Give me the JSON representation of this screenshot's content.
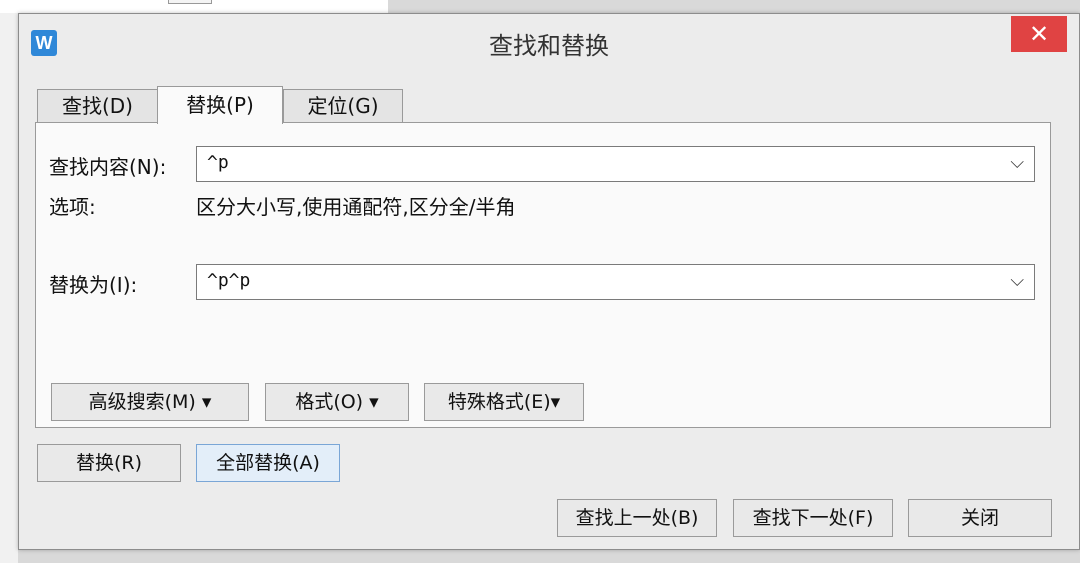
{
  "window": {
    "title": "查找和替换",
    "app_icon_letter": "W",
    "close_symbol": "✕"
  },
  "tabs": [
    {
      "label": "查找(D)"
    },
    {
      "label": "替换(P)",
      "active": true
    },
    {
      "label": "定位(G)"
    }
  ],
  "find": {
    "label": "查找内容(N):",
    "value": "^p"
  },
  "options": {
    "label": "选项:",
    "value": "区分大小写,使用通配符,区分全/半角"
  },
  "replace": {
    "label": "替换为(I):",
    "value": "^p^p"
  },
  "panel_buttons": {
    "advanced": "高级搜索(M) ▾",
    "format": "格式(O) ▾",
    "special": "特殊格式(E)▾"
  },
  "actions": {
    "replace": "替换(R)",
    "replace_all": "全部替换(A)",
    "find_prev": "查找上一处(B)",
    "find_next": "查找下一处(F)",
    "close": "关闭"
  },
  "icons": {
    "dropdown": "chevron-down-icon",
    "app": "wps-writer-icon"
  },
  "colors": {
    "close_button": "#e04343",
    "app_icon": "#2f88d8"
  }
}
